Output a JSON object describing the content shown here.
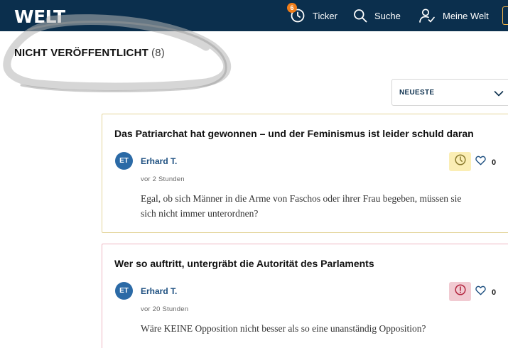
{
  "header": {
    "logo": "WELT",
    "nav": {
      "ticker_label": "Ticker",
      "ticker_badge": "6",
      "search_label": "Suche",
      "account_label": "Meine Welt"
    }
  },
  "section": {
    "title": "NICHT VERÖFFENTLICHT",
    "count": "(8)"
  },
  "sort": {
    "selected": "NEUESTE"
  },
  "comments": [
    {
      "title": "Das Patriarchat hat gewonnen – und der Feminismus ist leider schuld daran",
      "initials": "ET",
      "author": "Erhard T.",
      "time": "vor 2 Stunden",
      "text": "Egal, ob sich Männer in die Arme von Faschos oder ihrer Frau begeben, müssen sie sich nicht immer unterordnen?",
      "status_icon": "clock-icon",
      "likes": "0"
    },
    {
      "title": "Wer so auftritt, untergräbt die Autorität des Parlaments",
      "initials": "ET",
      "author": "Erhard T.",
      "time": "vor 20 Stunden",
      "text": "Wäre KEINE Opposition nicht besser als so eine unanständig Opposition?",
      "status_icon": "exclamation-circle-icon",
      "likes": "0"
    }
  ],
  "colors": {
    "header_bg": "#0b2f4d",
    "badge": "#ef7d1a",
    "pending_bg": "#fbeeb5",
    "pending_border": "#e4d49a",
    "rejected_bg": "#f1cbd2",
    "rejected_border": "#efb7c3",
    "author": "#1d4f80"
  }
}
